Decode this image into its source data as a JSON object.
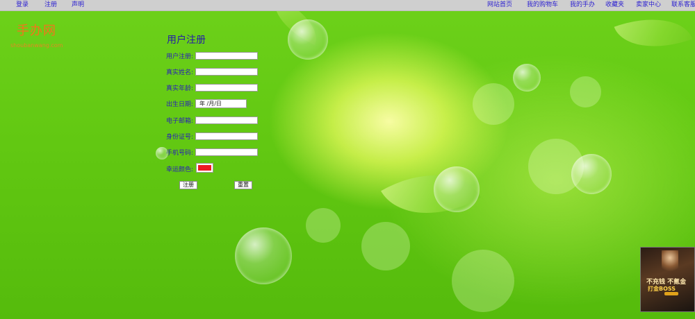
{
  "topnav": {
    "left": [
      "登录",
      "注册",
      "声明"
    ],
    "right": [
      "网站首页",
      "我的购物车",
      "我的手办",
      "收藏夹",
      "卖家中心",
      "联系客服"
    ]
  },
  "logo": {
    "title": "手办网",
    "subtitle": "shoubanwang.com"
  },
  "form": {
    "title": "用户注册",
    "fields": {
      "username": {
        "label": "用户注册:",
        "value": ""
      },
      "realname": {
        "label": "真实姓名:",
        "value": ""
      },
      "age": {
        "label": "真实年龄:",
        "value": ""
      },
      "birthdate": {
        "label": "出生日期:",
        "value": "年 /月/日"
      },
      "email": {
        "label": "电子邮箱:",
        "value": ""
      },
      "idcard": {
        "label": "身份证号:",
        "value": ""
      },
      "phone": {
        "label": "手机号码:",
        "value": ""
      },
      "lucky_color": {
        "label": "幸运颜色:",
        "value": "#ee1b23"
      }
    },
    "submit_label": "注册",
    "reset_label": "重置"
  },
  "ad": {
    "line1": "不充钱 不氪金",
    "line2": "打金BOSS"
  },
  "colors": {
    "link": "#2b1fd0",
    "logo": "#f2741c",
    "background": "#62c812"
  }
}
